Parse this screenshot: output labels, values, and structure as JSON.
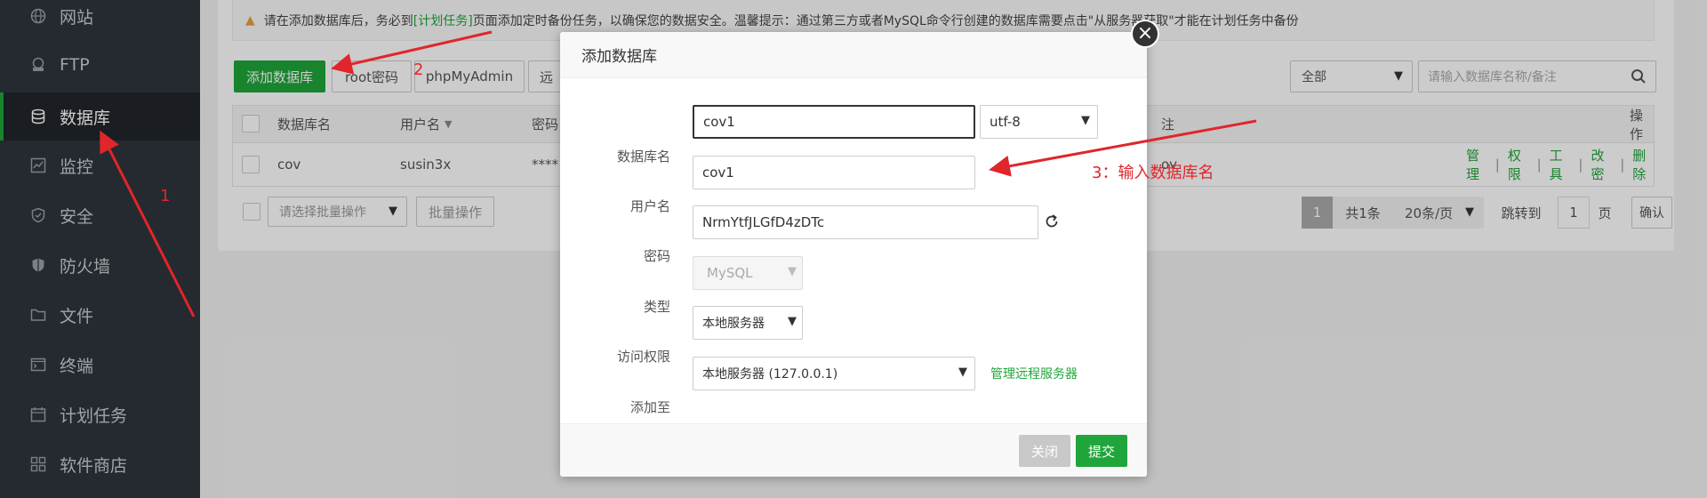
{
  "sidebar": {
    "items": [
      {
        "label": "网站",
        "icon": "globe-icon"
      },
      {
        "label": "FTP",
        "icon": "ftp-icon"
      },
      {
        "label": "数据库",
        "icon": "database-icon"
      },
      {
        "label": "监控",
        "icon": "monitor-icon"
      },
      {
        "label": "安全",
        "icon": "shield-icon"
      },
      {
        "label": "防火墙",
        "icon": "firewall-icon"
      },
      {
        "label": "文件",
        "icon": "folder-icon"
      },
      {
        "label": "终端",
        "icon": "terminal-icon"
      },
      {
        "label": "计划任务",
        "icon": "calendar-icon"
      },
      {
        "label": "软件商店",
        "icon": "apps-icon"
      }
    ]
  },
  "alert": {
    "prefix": "请在添加数据库后，务必到",
    "link": "[计划任务]",
    "suffix": "页面添加定时备份任务，以确保您的数据安全。温馨提示：通过第三方或者MySQL命令行创建的数据库需要点击\"从服务器获取\"才能在计划任务中备份"
  },
  "toolbar": {
    "add_db": "添加数据库",
    "root_password": "root密码",
    "phpmyadmin": "phpMyAdmin",
    "remote": "远",
    "filter_value": "全部",
    "search_placeholder": "请输入数据库名称/备注"
  },
  "table": {
    "headers": {
      "name": "数据库名",
      "user": "用户名",
      "password": "密码",
      "note": "注",
      "ops": "操作"
    },
    "rows": [
      {
        "name": "cov",
        "user": "susin3x",
        "password": "****",
        "note": "ov"
      }
    ],
    "ops": [
      "管理",
      "权限",
      "工具",
      "改密",
      "删除"
    ],
    "sep": "|"
  },
  "batch": {
    "select_placeholder": "请选择批量操作",
    "button": "批量操作"
  },
  "pager": {
    "current": "1",
    "total": "共1条",
    "per_page": "20条/页",
    "goto": "跳转到",
    "goto_value": "1",
    "page_unit": "页",
    "confirm": "确认"
  },
  "modal": {
    "title": "添加数据库",
    "fields": {
      "dbname_label": "数据库名",
      "dbname_value": "cov1",
      "charset_value": "utf-8",
      "user_label": "用户名",
      "user_value": "cov1",
      "password_label": "密码",
      "password_value": "NrmYtfJLGfD4zDTc",
      "type_label": "类型",
      "type_value": "MySQL",
      "access_label": "访问权限",
      "access_value": "本地服务器",
      "addto_label": "添加至",
      "addto_value": "本地服务器 (127.0.0.1)",
      "manage_remote": "管理远程服务器"
    },
    "close_button": "关闭",
    "submit_button": "提交"
  },
  "annotations": {
    "num1": "1",
    "num2": "2",
    "num3": "3：输入数据库名",
    "color": "#e0262b"
  }
}
